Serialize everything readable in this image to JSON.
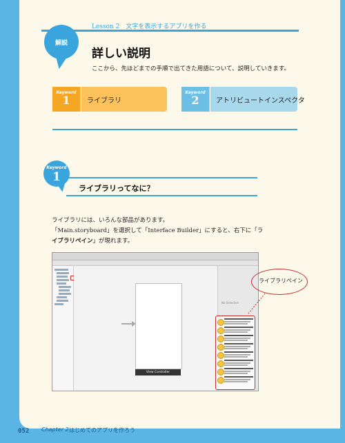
{
  "header": {
    "lesson": "Lesson 2　文字を表示するアプリを作る",
    "badge": "解説",
    "title": "詳しい説明",
    "intro": "ここから、先ほどまでの手順で出てきた用語について、説明していきます。"
  },
  "keywords": [
    {
      "tag": "Keyword",
      "number": "1",
      "label": "ライブラリ",
      "color": "#f5a623"
    },
    {
      "tag": "Keyword",
      "number": "2",
      "label": "アトリビュートインスペクタ",
      "color": "#6cc0e6"
    }
  ],
  "section": {
    "tag": "Keyword",
    "number": "1",
    "title": "ライブラリってなに？",
    "line1": "ライブラリには、いろんな部品があります。",
    "line2": "「Main.storyboard」を選択して「Interface Builder」にすると、右下に「ラ",
    "line3_bold": "イブラリペイン",
    "line3_rest": "」が現れます。"
  },
  "screenshot": {
    "vc_label": "View Controller",
    "no_selection": "No Selection",
    "callout": "ライブラリペイン"
  },
  "footer": {
    "page": "052",
    "chapter": "Chapter 2",
    "title": "はじめてのアプリを作ろう"
  },
  "colors": {
    "accent": "#3aa5dc",
    "orange": "#f5a623",
    "light_blue": "#a8d8ec",
    "callout_red": "#c62828"
  }
}
